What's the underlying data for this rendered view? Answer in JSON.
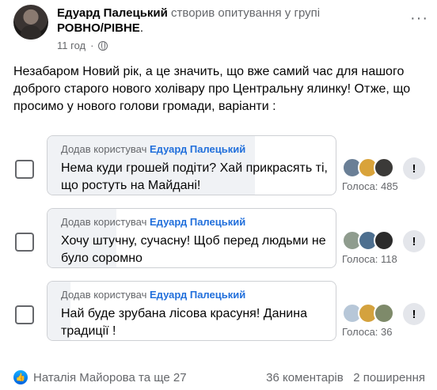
{
  "post": {
    "author": "Едуард Палецький",
    "action": "створив опитування у групі",
    "group": "РОВНО/РІВНЕ",
    "group_suffix": ".",
    "time": "11 год",
    "privacy_icon": "globe-icon",
    "more_label": "···",
    "body": "Незабаром Новий рік, а це значить, що вже самий час для нашого доброго старого нового холівару про Центральну ялинку! Отже, що просимо у нового голови громади, варіанти :"
  },
  "poll": {
    "options": [
      {
        "added_prefix": "Додав користувач",
        "added_by": "Едуард Палецький",
        "text": "Нема куди грошей подіти? Хай прикрасять ті, що ростуть на Майдані!",
        "votes_label": "Голоса: 485",
        "votes": 485,
        "fill_fraction": 0.72,
        "voter_colors": [
          "#6a7f96",
          "#d9a33a",
          "#3b3a38"
        ]
      },
      {
        "added_prefix": "Додав користувач",
        "added_by": "Едуард Палецький",
        "text": "Хочу штучну, сучасну! Щоб перед людьми не було соромно",
        "votes_label": "Голоса: 118",
        "votes": 118,
        "fill_fraction": 0.24,
        "voter_colors": [
          "#8f9c8e",
          "#4d6f8f",
          "#2b2b2b"
        ]
      },
      {
        "added_prefix": "Додав користувач",
        "added_by": "Едуард Палецький",
        "text": "Най буде зрубана лісова красуня! Данина традиції !",
        "votes_label": "Голоса: 36",
        "votes": 36,
        "fill_fraction": 0.08,
        "voter_colors": [
          "#b7c7d8",
          "#d4a23e",
          "#7e8a6a"
        ]
      }
    ],
    "flag_label": "!"
  },
  "footer": {
    "like_icon": "like-icon",
    "reactors": "Наталія Майорова та ще 27",
    "comments": "36 коментарів",
    "shares": "2 поширення"
  }
}
